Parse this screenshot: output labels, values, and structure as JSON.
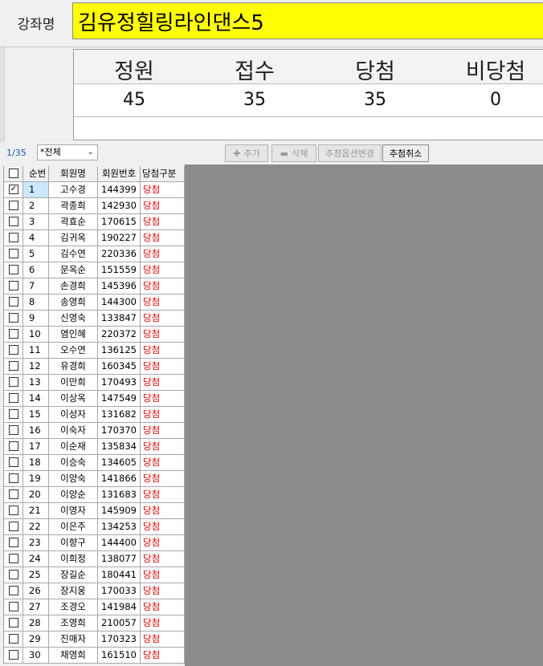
{
  "course": {
    "label": "강좌명",
    "name": "김유정힐링라인댄스5"
  },
  "stats": {
    "headers": [
      "정원",
      "접수",
      "당첨",
      "비당첨"
    ],
    "values": [
      "45",
      "35",
      "35",
      "0"
    ]
  },
  "toolbar": {
    "count": "1/35",
    "filter": "*전체",
    "add_label": "추가",
    "delete_label": "삭제",
    "option_label": "추첨옵션변경",
    "cancel_label": "추첨취소"
  },
  "table": {
    "headers": [
      "순번",
      "회원명",
      "회원번호",
      "당첨구분"
    ],
    "rows": [
      {
        "no": "1",
        "name": "고수경",
        "id": "144399",
        "status": "당첨",
        "checked": true
      },
      {
        "no": "2",
        "name": "곽종희",
        "id": "142930",
        "status": "당첨"
      },
      {
        "no": "3",
        "name": "곽효순",
        "id": "170615",
        "status": "당첨"
      },
      {
        "no": "4",
        "name": "김귀옥",
        "id": "190227",
        "status": "당첨"
      },
      {
        "no": "5",
        "name": "김수연",
        "id": "220336",
        "status": "당첨"
      },
      {
        "no": "6",
        "name": "문옥순",
        "id": "151559",
        "status": "당첨"
      },
      {
        "no": "7",
        "name": "손경희",
        "id": "145396",
        "status": "당첨"
      },
      {
        "no": "8",
        "name": "송영희",
        "id": "144300",
        "status": "당첨"
      },
      {
        "no": "9",
        "name": "신영숙",
        "id": "133847",
        "status": "당첨"
      },
      {
        "no": "10",
        "name": "염인혜",
        "id": "220372",
        "status": "당첨"
      },
      {
        "no": "11",
        "name": "오수연",
        "id": "136125",
        "status": "당첨"
      },
      {
        "no": "12",
        "name": "유경희",
        "id": "160345",
        "status": "당첨"
      },
      {
        "no": "13",
        "name": "이만희",
        "id": "170493",
        "status": "당첨"
      },
      {
        "no": "14",
        "name": "이상옥",
        "id": "147549",
        "status": "당첨"
      },
      {
        "no": "15",
        "name": "이성자",
        "id": "131682",
        "status": "당첨"
      },
      {
        "no": "16",
        "name": "이숙자",
        "id": "170370",
        "status": "당첨"
      },
      {
        "no": "17",
        "name": "이순재",
        "id": "135834",
        "status": "당첨"
      },
      {
        "no": "18",
        "name": "이승숙",
        "id": "134605",
        "status": "당첨"
      },
      {
        "no": "19",
        "name": "이양숙",
        "id": "141866",
        "status": "당첨"
      },
      {
        "no": "20",
        "name": "이양순",
        "id": "131683",
        "status": "당첨"
      },
      {
        "no": "21",
        "name": "이영자",
        "id": "145909",
        "status": "당첨"
      },
      {
        "no": "22",
        "name": "이은주",
        "id": "134253",
        "status": "당첨"
      },
      {
        "no": "23",
        "name": "이향구",
        "id": "144400",
        "status": "당첨"
      },
      {
        "no": "24",
        "name": "이희정",
        "id": "138077",
        "status": "당첨"
      },
      {
        "no": "25",
        "name": "장길순",
        "id": "180441",
        "status": "당첨"
      },
      {
        "no": "26",
        "name": "장지웅",
        "id": "170033",
        "status": "당첨"
      },
      {
        "no": "27",
        "name": "조경오",
        "id": "141984",
        "status": "당첨"
      },
      {
        "no": "28",
        "name": "조영희",
        "id": "210057",
        "status": "당첨"
      },
      {
        "no": "29",
        "name": "진매자",
        "id": "170323",
        "status": "당첨"
      },
      {
        "no": "30",
        "name": "채영희",
        "id": "161510",
        "status": "당첨"
      }
    ]
  }
}
